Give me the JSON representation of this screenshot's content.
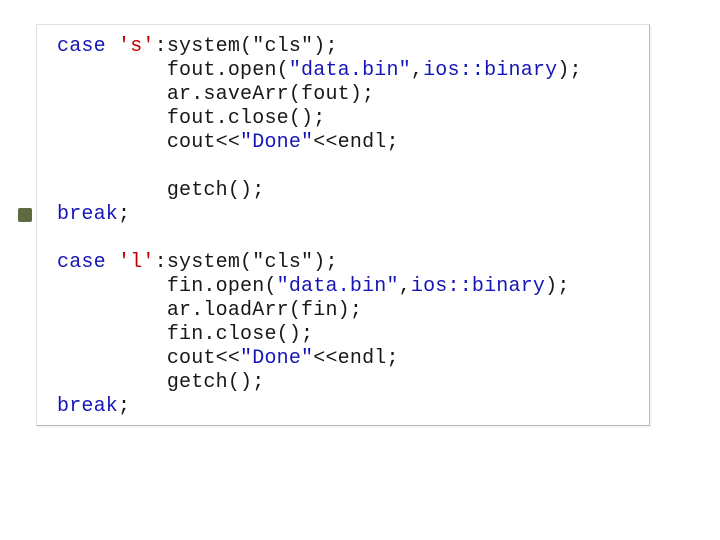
{
  "code": {
    "kw_case": "case",
    "kw_break": "break",
    "ios_binary": "ios::binary",
    "save_case": {
      "char": "'s'",
      "sys_cls": "system(\"cls\");",
      "fout_open_a": "fout.open(",
      "open_file": "\"data.bin\"",
      "fout_open_b": ",",
      "fout_open_c": ");",
      "save_call": "ar.saveArr(fout);",
      "fout_close": "fout.close();",
      "cout_done_a": "cout<<",
      "done_str": "\"Done\"",
      "cout_done_b": "<<endl;",
      "getch": "getch();"
    },
    "load_case": {
      "char": "'l'",
      "sys_cls": "system(\"cls\");",
      "fin_open_a": "fin.open(",
      "open_file": "\"data.bin\"",
      "fin_open_b": ",",
      "fin_open_c": ");",
      "load_call": "ar.loadArr(fin);",
      "fin_close": "fin.close();",
      "cout_done_a": "cout<<",
      "done_str": "\"Done\"",
      "cout_done_b": "<<endl;",
      "getch": "getch();"
    }
  }
}
